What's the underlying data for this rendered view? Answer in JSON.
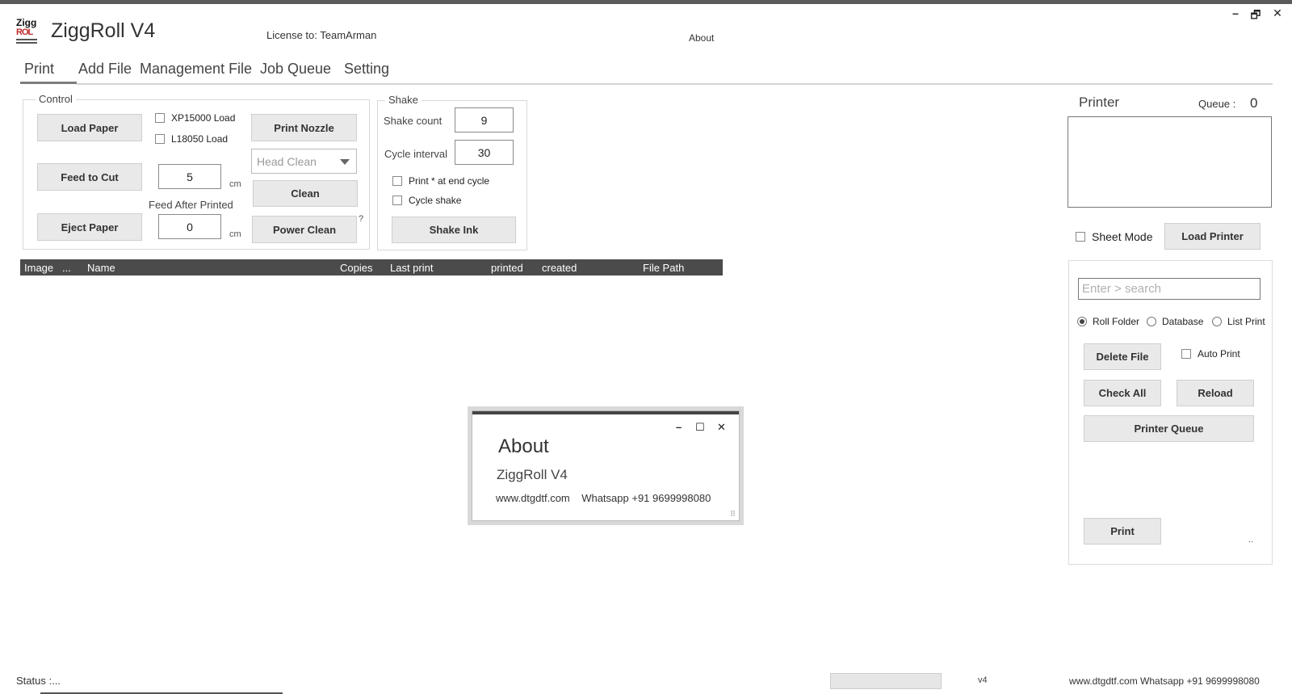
{
  "window": {
    "minimize": "–",
    "restore": "🗗",
    "close": "✕"
  },
  "logo": {
    "line1": "Zigg",
    "line2": "ROL"
  },
  "app": {
    "title": "ZiggRoll V4",
    "license": "License to: TeamArman",
    "about_link": "About"
  },
  "tabs": [
    "Print",
    "Add File",
    "Management File",
    "Job Queue",
    "Setting"
  ],
  "control": {
    "legend": "Control",
    "load_paper": "Load Paper",
    "feed_to_cut": "Feed to Cut",
    "eject_paper": "Eject Paper",
    "xp15000_load": "XP15000 Load",
    "l18050_load": "L18050 Load",
    "feed_value": "5",
    "feed_unit": "cm",
    "feed_after_label": "Feed After Printed",
    "feed_after_value": "0",
    "feed_after_unit": "cm",
    "print_nozzle": "Print Nozzle",
    "head_clean": "Head Clean",
    "clean": "Clean",
    "power_clean": "Power Clean",
    "help": "?"
  },
  "shake": {
    "legend": "Shake",
    "count_label": "Shake count",
    "count_value": "9",
    "interval_label": "Cycle interval",
    "interval_value": "30",
    "print_end_cycle": "Print * at end cycle",
    "cycle_shake": "Cycle shake",
    "shake_ink": "Shake Ink"
  },
  "grid": {
    "columns": [
      "Image",
      "...",
      "Name",
      "Copies",
      "Last print",
      "printed",
      "created",
      "File Path"
    ]
  },
  "printer": {
    "label": "Printer",
    "queue_label": "Queue :",
    "queue_count": "0",
    "sheet_mode": "Sheet Mode",
    "load_printer": "Load Printer"
  },
  "files": {
    "search_placeholder": "Enter > search",
    "radio_roll": "Roll Folder",
    "radio_db": "Database",
    "radio_list": "List Print",
    "delete_file": "Delete File",
    "auto_print": "Auto Print",
    "check_all": "Check All",
    "reload": "Reload",
    "printer_queue": "Printer Queue",
    "print": "Print",
    "ellipsis": ".."
  },
  "about_dialog": {
    "title": "About",
    "name": "ZiggRoll V4",
    "info": "www.dtgdtf.com    Whatsapp +91 9699998080",
    "minimize": "–",
    "maximize": "☐",
    "close": "✕",
    "grip": "⠿"
  },
  "statusbar": {
    "status": "Status :...",
    "version": "v4",
    "info": "www.dtgdtf.com Whatsapp +91 9699998080"
  }
}
